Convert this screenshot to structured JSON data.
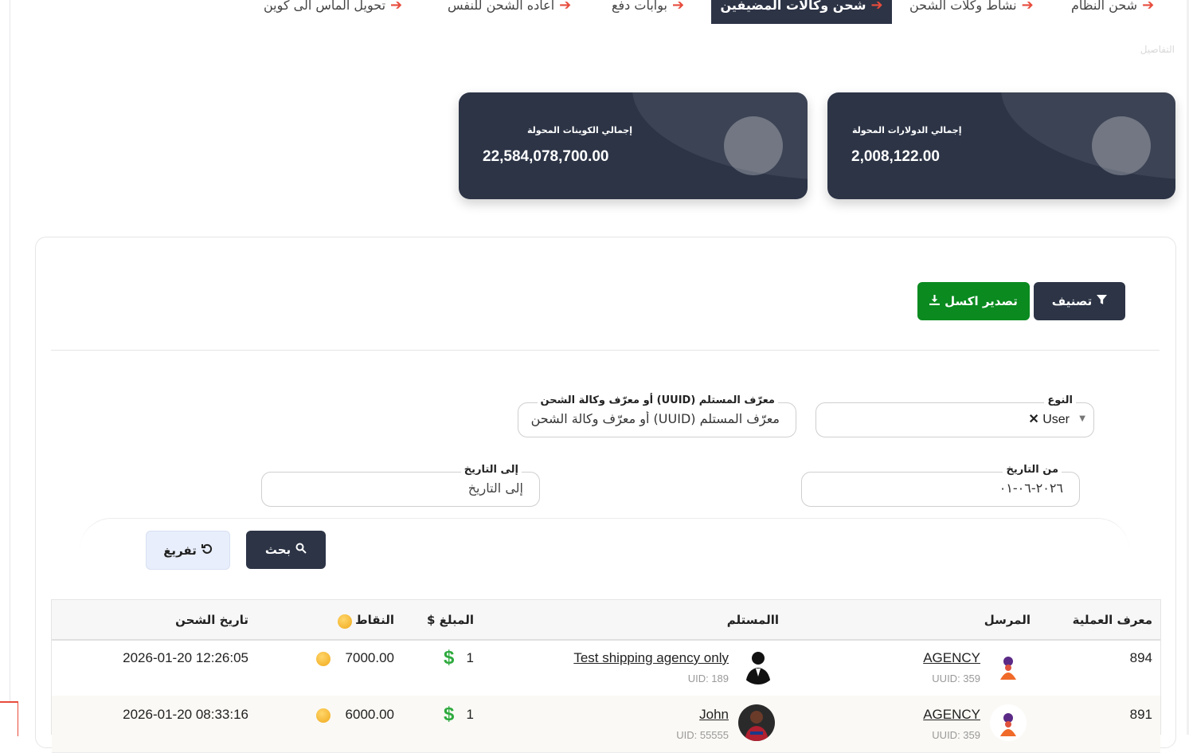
{
  "tabs": [
    {
      "label": "شحن النظام",
      "active": false
    },
    {
      "label": "نشاط وكلات الشحن",
      "active": false
    },
    {
      "label": "شحن وكالات المضيفين",
      "active": true
    },
    {
      "label": "بوابات دفع",
      "active": false
    },
    {
      "label": "اعاده الشحن للنفس",
      "active": false
    },
    {
      "label": "تحويل الماس الى كوين",
      "active": false
    }
  ],
  "details_label": "التفاصيل",
  "stats": {
    "dollars": {
      "label": "إجمالي الدولارات المحولة",
      "value": "2,008,122.00"
    },
    "coins": {
      "label": "إجمالي الكوينات المحولة",
      "value": "22,584,078,700.00"
    }
  },
  "toolbar": {
    "classify_label": "تصنيف",
    "export_label": "تصدير اكسل"
  },
  "filters": {
    "type": {
      "label": "النوع",
      "value": "User"
    },
    "recipient": {
      "label": "معرّف المستلم (UUID) أو معرّف وكالة الشحن",
      "placeholder": "معرّف المستلم (UUID) أو معرّف وكالة الشحن"
    },
    "from_date": {
      "label": "من التاريخ",
      "value": "٢٠٢٦-٠٦-٠١"
    },
    "to_date": {
      "label": "إلى التاريخ",
      "placeholder": "إلى التاريخ"
    },
    "search_label": "بحث",
    "reset_label": "تفريغ"
  },
  "table": {
    "headers": {
      "id": "معرف العملية",
      "sender": "المرسل",
      "recipient": "االمستلم",
      "amount": "المبلغ $",
      "points": "النقاط",
      "date": "تاريخ الشحن"
    },
    "rows": [
      {
        "id": "894",
        "sender": "AGENCY",
        "sender_sub": "UUID: 359",
        "recipient": "Test shipping agency only",
        "recipient_sub": "UID: 189",
        "amount": "1",
        "points": "7000.00",
        "date": "2026-01-20 12:26:05"
      },
      {
        "id": "891",
        "sender": "AGENCY",
        "sender_sub": "UUID: 359",
        "recipient": "John",
        "recipient_sub": "UID: 55555",
        "amount": "1",
        "points": "6000.00",
        "date": "2026-01-20 08:33:16"
      }
    ]
  },
  "colors": {
    "card_bg": "#2c3446",
    "accent_arrow": "#e74c3c",
    "export_green": "#0a8a1f",
    "dollar_green": "#2eaa3e",
    "coin_gold": "#f0a91b"
  }
}
